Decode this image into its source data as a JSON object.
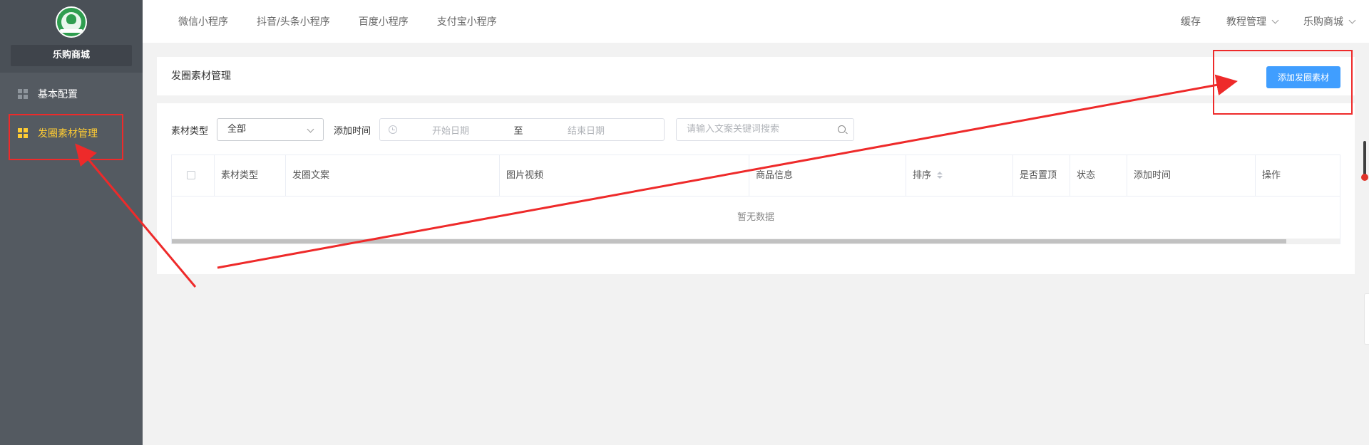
{
  "sidebar": {
    "shop_name": "乐购商城",
    "items": [
      {
        "label": "基本配置",
        "icon": "grid-icon"
      },
      {
        "label": "发圈素材管理",
        "icon": "grid-icon",
        "active": true
      }
    ]
  },
  "topbar": {
    "left_tabs": [
      "微信小程序",
      "抖音/头条小程序",
      "百度小程序",
      "支付宝小程序"
    ],
    "right_items": [
      {
        "label": "缓存"
      },
      {
        "label": "教程管理",
        "dropdown": true
      },
      {
        "label": "乐购商城",
        "dropdown": true
      }
    ]
  },
  "header": {
    "title": "发圈素材管理",
    "add_button": "添加发圈素材"
  },
  "filters": {
    "type_label": "素材类型",
    "type_value": "全部",
    "time_label": "添加时间",
    "start_placeholder": "开始日期",
    "range_separator": "至",
    "end_placeholder": "结束日期",
    "search_placeholder": "请输入文案关键词搜索"
  },
  "table": {
    "columns": [
      "素材类型",
      "发圈文案",
      "图片视频",
      "商品信息",
      "排序",
      "是否置顶",
      "状态",
      "添加时间",
      "操作"
    ],
    "empty_text": "暂无数据"
  },
  "colors": {
    "sidebar_bg": "#545a61",
    "active_accent": "#ffcc33",
    "primary_button": "#409eff",
    "annotation_red": "#ee2a2a"
  }
}
